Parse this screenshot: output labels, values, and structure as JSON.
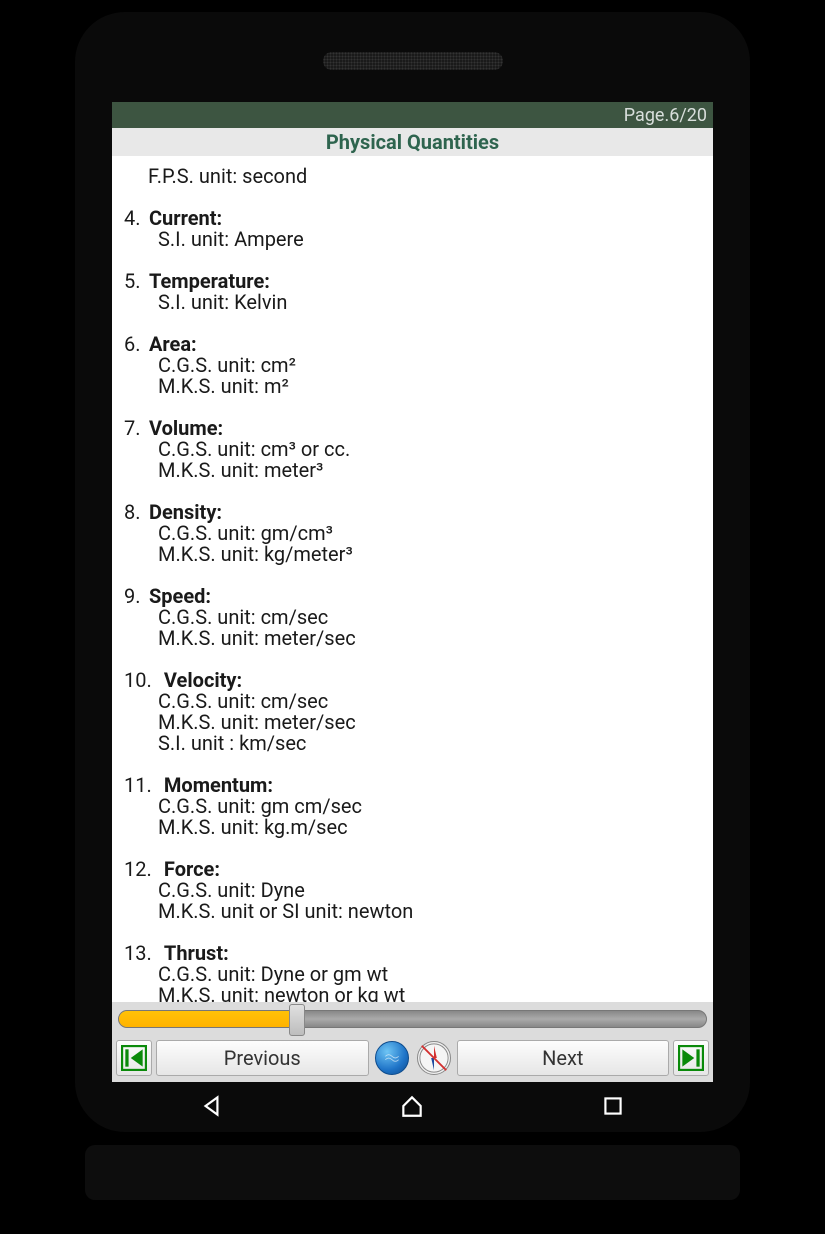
{
  "status": {
    "page_indicator": "Page.6/20"
  },
  "title": "Physical Quantities",
  "first_line": "F.P.S. unit: second",
  "entries": [
    {
      "num": "4.",
      "title": "Current:",
      "lines": [
        "S.I.   unit: Ampere"
      ]
    },
    {
      "num": "5.",
      "title": "Temperature:",
      "lines": [
        "S.I.   unit: Kelvin"
      ]
    },
    {
      "num": "6.",
      "title": "Area:",
      "lines": [
        "C.G.S. unit: cm²",
        "M.K.S. unit: m²"
      ]
    },
    {
      "num": "7.",
      "title": "Volume:",
      "lines": [
        "C.G.S. unit: cm³ or cc.",
        "M.K.S. unit: meter³"
      ]
    },
    {
      "num": "8.",
      "title": "Density:",
      "lines": [
        "C.G.S. unit: gm/cm³",
        "M.K.S. unit: kg/meter³"
      ]
    },
    {
      "num": "9.",
      "title": "Speed:",
      "lines": [
        "C.G.S. unit: cm/sec",
        "M.K.S. unit: meter/sec"
      ]
    },
    {
      "num": "10.",
      "title": "Velocity:",
      "lines": [
        "C.G.S. unit: cm/sec",
        "M.K.S. unit: meter/sec",
        "S.I. unit : km/sec"
      ]
    },
    {
      "num": "11.",
      "title": "Momentum:",
      "lines": [
        "C.G.S. unit: gm cm/sec",
        "M.K.S. unit: kg.m/sec"
      ]
    },
    {
      "num": "12.",
      "title": "Force:",
      "lines": [
        "C.G.S. unit: Dyne",
        "M.K.S. unit or SI unit: newton"
      ]
    },
    {
      "num": "13.",
      "title": "Thrust:",
      "lines": [
        "C.G.S. unit: Dyne or gm wt",
        "M.K.S. unit: newton or kg wt"
      ]
    }
  ],
  "slider": {
    "percent": 30
  },
  "nav": {
    "previous": "Previous",
    "next": "Next"
  }
}
